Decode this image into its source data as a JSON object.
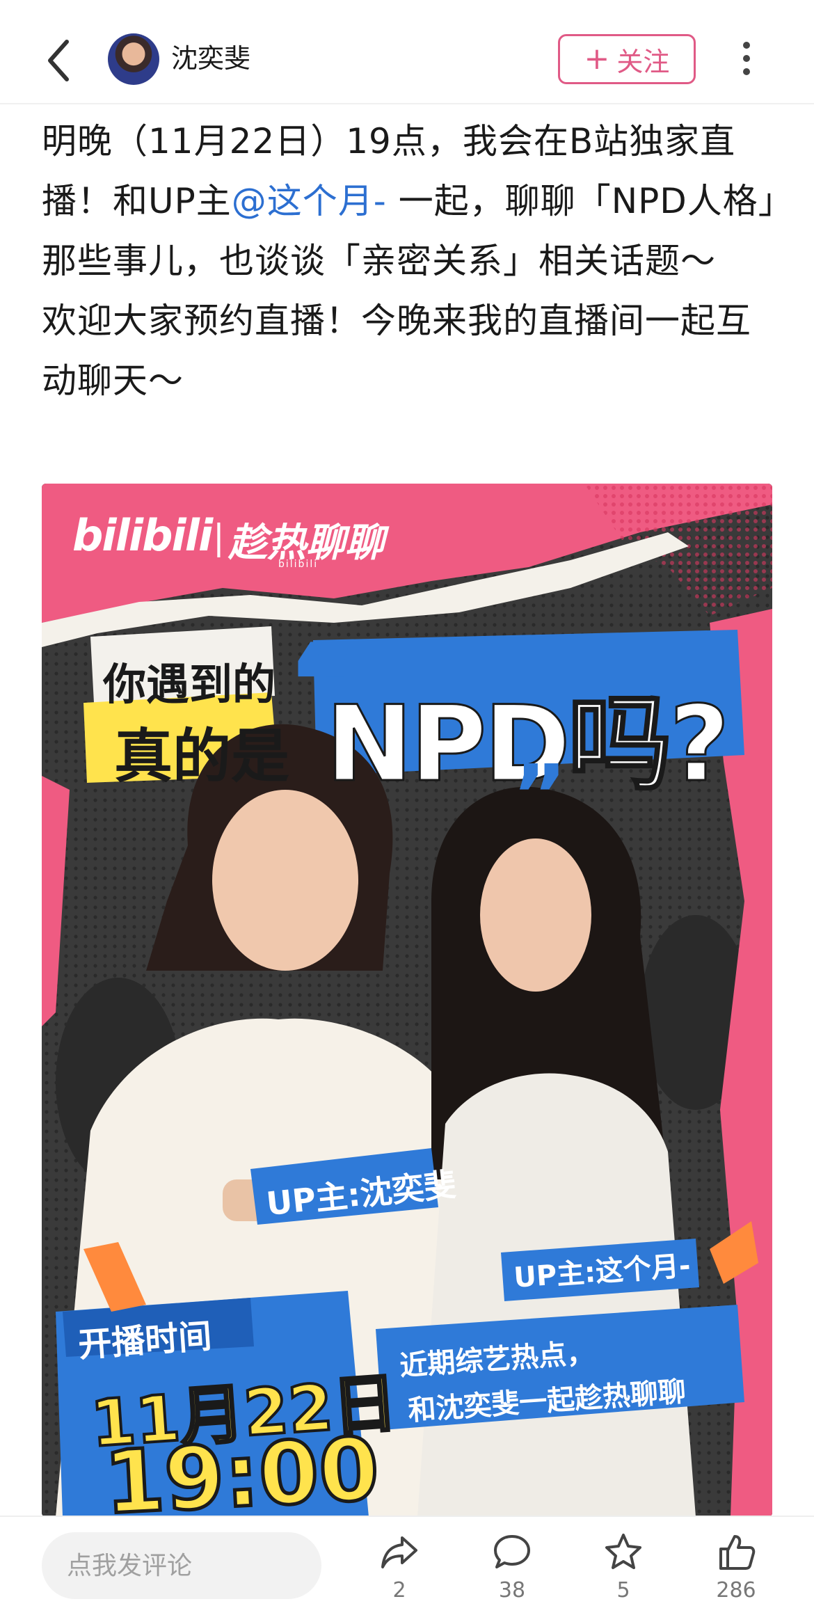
{
  "header": {
    "author_name": "沈奕斐",
    "follow_label": "关注",
    "follow_plus": "+"
  },
  "post": {
    "text_before_mention": "明晚（11月22日）19点，我会在B站独家直播！和UP主",
    "mention": "@这个月-",
    "text_after_mention": " 一起，聊聊「NPD人格」那些事儿，也谈谈「亲密关系」相关话题～",
    "text_line2": "欢迎大家预约直播！今晚来我的直播间一起互动聊天～"
  },
  "poster": {
    "bili_logo": "bilibili",
    "divider": "|",
    "show_name": "趁热聊聊",
    "show_sub": "bilibili",
    "question_line1": "你遇到的",
    "question_line2": "真的是",
    "open_quote": "“",
    "question_npd": "NPD吗?",
    "close_quote": "”",
    "up1": "UP主:沈奕斐",
    "up2": "UP主:这个月-",
    "time_label": "开播时间",
    "time_date": "11月22日",
    "time_hour": "19:00",
    "slogan1": "近期综艺热点，",
    "slogan2": "和沈奕斐一起趁热聊聊"
  },
  "bottom_bar": {
    "comment_placeholder": "点我发评论",
    "share_count": "2",
    "comment_count": "38",
    "favorite_count": "5",
    "like_count": "286"
  },
  "colors": {
    "accent_pink": "#e05a86",
    "mention_blue": "#2c6fd1",
    "poster_pink": "#ef5b82",
    "poster_blue": "#2f7ad8",
    "poster_yellow": "#ffe34d"
  },
  "icons": [
    "back-chevron-icon",
    "more-dots-icon",
    "share-icon",
    "comment-icon",
    "star-icon",
    "like-icon"
  ]
}
